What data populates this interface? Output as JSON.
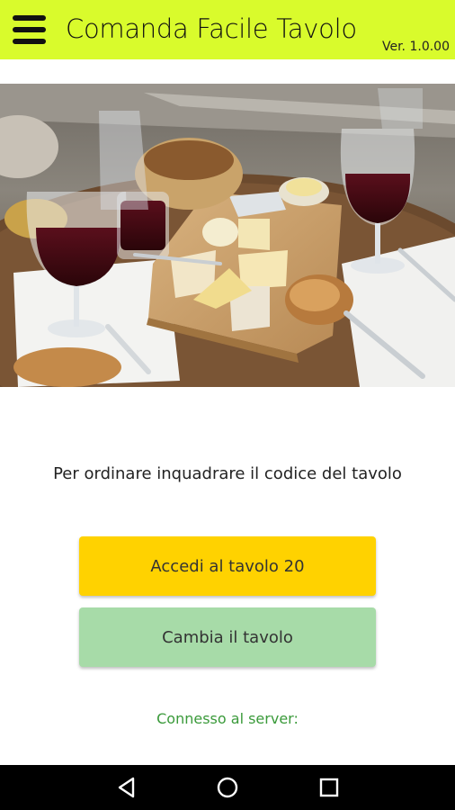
{
  "header": {
    "title": "Comanda Facile Tavolo",
    "version": "Ver. 1.0.00",
    "bg_color": "#d9fb2c",
    "menu_icon": "hamburger-icon"
  },
  "hero": {
    "icon": "food-photo"
  },
  "main": {
    "prompt": "Per ordinare inquadrare il codice del tavolo",
    "primary_button": "Accedi al tavolo 20",
    "primary_color": "#ffd200",
    "secondary_button": "Cambia il tavolo",
    "secondary_color": "#a7dba8",
    "status": "Connesso al server:",
    "status_color": "#3a9a3a"
  },
  "navbar": {
    "icons": [
      "back-icon",
      "home-icon",
      "recents-icon"
    ]
  }
}
